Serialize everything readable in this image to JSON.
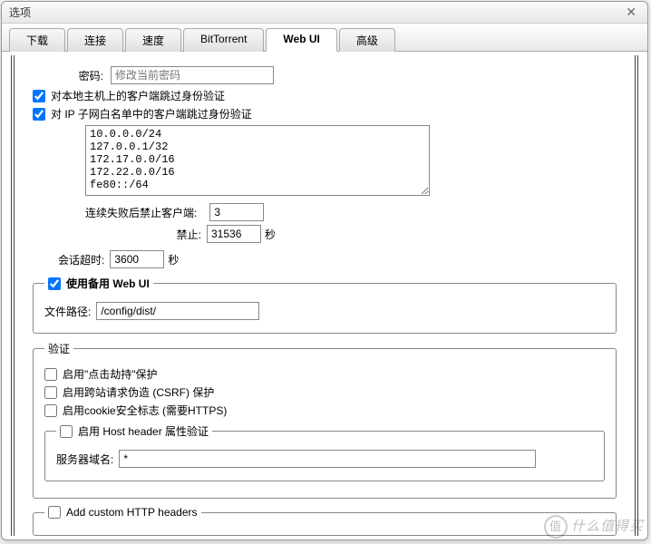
{
  "dialog": {
    "title": "选项"
  },
  "tabs": {
    "download": "下载",
    "connection": "连接",
    "speed": "速度",
    "bittorrent": "BitTorrent",
    "webui": "Web UI",
    "advanced": "高级"
  },
  "auth": {
    "password_label": "密码:",
    "password_placeholder": "修改当前密码",
    "bypass_local": "对本地主机上的客户端跳过身份验证",
    "bypass_whitelist": "对 IP 子网白名单中的客户端跳过身份验证",
    "whitelist_value": "10.0.0.0/24\n127.0.0.1/32\n172.17.0.0/16\n172.22.0.0/16\nfe80::/64",
    "ban_after_label": "连续失败后禁止客户端:",
    "ban_after_value": "3",
    "ban_for_label": "禁止:",
    "ban_for_value": "31536",
    "ban_for_suffix": "秒",
    "session_timeout_label": "会话超时:",
    "session_timeout_value": "3600",
    "session_timeout_suffix": "秒"
  },
  "altwebui": {
    "enable": "使用备用 Web UI",
    "path_label": "文件路径:",
    "path_value": "/config/dist/"
  },
  "security": {
    "legend": "验证",
    "clickjacking": "启用\"点击劫持\"保护",
    "csrf": "启用跨站请求伪造 (CSRF) 保护",
    "secure_cookie": "启用cookie安全标志 (需要HTTPS)",
    "host_header": "启用 Host header 属性验证",
    "server_domain_label": "服务器域名:",
    "server_domain_value": "*"
  },
  "custom_headers": {
    "legend": "Add custom HTTP headers"
  },
  "watermark": "什么值得买"
}
